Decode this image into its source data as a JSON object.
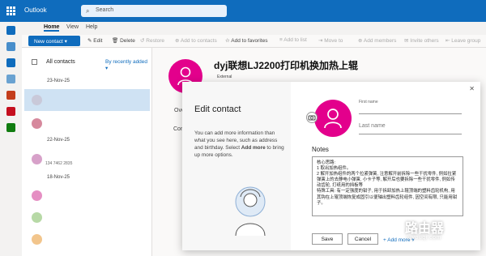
{
  "app": {
    "title": "Outlook",
    "search_placeholder": "Search"
  },
  "menu": {
    "home": "Home",
    "view": "View",
    "help": "Help"
  },
  "toolbar": {
    "new_contact": "New contact",
    "edit": "Edit",
    "delete": "Delete",
    "restore": "Restore",
    "add_to_contacts": "Add to contacts",
    "add_to_favorites": "Add to favorites",
    "add_to_list": "Add to list",
    "move_to": "Move to",
    "add_members": "Add members",
    "invite_others": "Invite others",
    "leave_group": "Leave group"
  },
  "list": {
    "header": "All contacts",
    "sort": "By recently added",
    "groups": [
      {
        "date": "23-Nov-25"
      },
      {
        "date": "22-Nov-25",
        "sub": "134 7462 2835"
      },
      {
        "date": "18-Nov-25"
      }
    ]
  },
  "contact": {
    "name": "dyj联想LJ2200打印机换加热上辊",
    "type": "External",
    "tab_overview": "Ove",
    "tab_contact": "Con"
  },
  "modal": {
    "title": "Edit contact",
    "desc_pre": "You can add more information than what you see here, such as address and birthday. Select ",
    "desc_bold": "Add more",
    "desc_post": " to bring up more options.",
    "first_name_label": "First name",
    "last_name_placeholder": "Last name",
    "notes_label": "Notes",
    "notes_lines": [
      "核心思路:",
      "1 取出加热组件。",
      "2 解开加热组件的两个拉紧弹簧, 注意解开前拆除一些干扰零件, 例如拉紧弹簧上的去静电小弹簧, 小卡子等, 解开后也要拆除一些干扰零件, 例如传动齿轮, 打纸用的挡板等",
      "特殊工具: 有一定强度的钳子, 用于拆卸加热上辊顶端的塑料齿轮机构, 用其钩在上辊顶端恢复成固引以便轴出塑料齿轮组件, 因空间有限, 只能用钳子。"
    ],
    "save": "Save",
    "cancel": "Cancel",
    "add_more": "Add more",
    "close": "✕"
  },
  "watermark": {
    "title": "路由器",
    "url": "luyouqi.com"
  },
  "colors": {
    "brand": "#0f6cbd",
    "avatar": "#e3008c",
    "selected_row": "#cfe2f3"
  },
  "icons": [
    "waffle-icon",
    "search-icon",
    "mail-icon",
    "calendar-icon",
    "people-icon",
    "todo-icon",
    "camera-icon",
    "user-silhouette-icon"
  ]
}
